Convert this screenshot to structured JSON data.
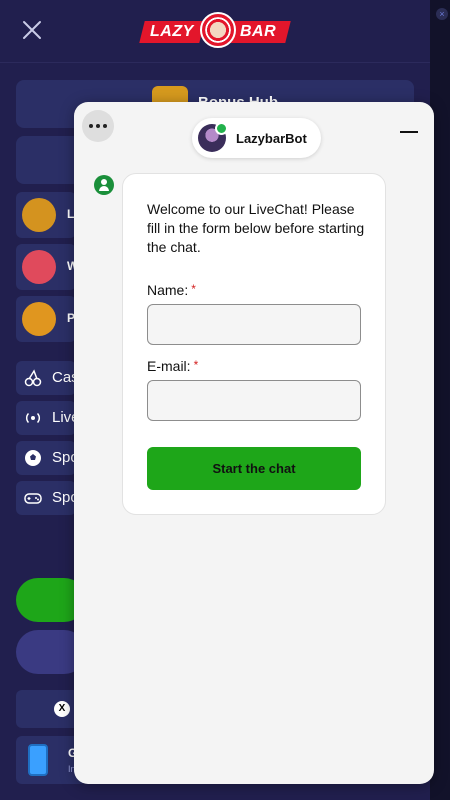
{
  "background_menu": {
    "logo": {
      "left_text": "LAZY",
      "right_text": "BAR"
    },
    "bonus_hub_label": "Bonus Hub",
    "promo_items": [
      {
        "label": "L",
        "icon": "shield-gem-icon",
        "color": "#d4931f"
      },
      {
        "label": "W",
        "icon": "wheel-icon",
        "color": "#e04a5c"
      },
      {
        "label": "P",
        "icon": "percent-coin-icon",
        "color": "#e0961f"
      }
    ],
    "nav_items": [
      {
        "label": "Cas",
        "icon": "cherry-icon"
      },
      {
        "label": "Live",
        "icon": "broadcast-icon"
      },
      {
        "label": "Spo",
        "icon": "soccer-ball-icon"
      },
      {
        "label": "Spo",
        "icon": "gamepad-icon"
      }
    ],
    "app_card": {
      "title": "G",
      "subtitle": "In"
    },
    "colors": {
      "accent_green": "#1ea619",
      "panel": "#2b2f66"
    }
  },
  "chat": {
    "agent_name": "LazybarBot",
    "welcome_message": "Welcome to our LiveChat! Please fill in the form below before starting the chat.",
    "fields": [
      {
        "label": "Name:",
        "required_mark": "*",
        "value": ""
      },
      {
        "label": "E-mail:",
        "required_mark": "*",
        "value": ""
      }
    ],
    "submit_label": "Start the chat",
    "colors": {
      "submit": "#1ea619",
      "online": "#22b14c",
      "required": "#d32020"
    }
  }
}
